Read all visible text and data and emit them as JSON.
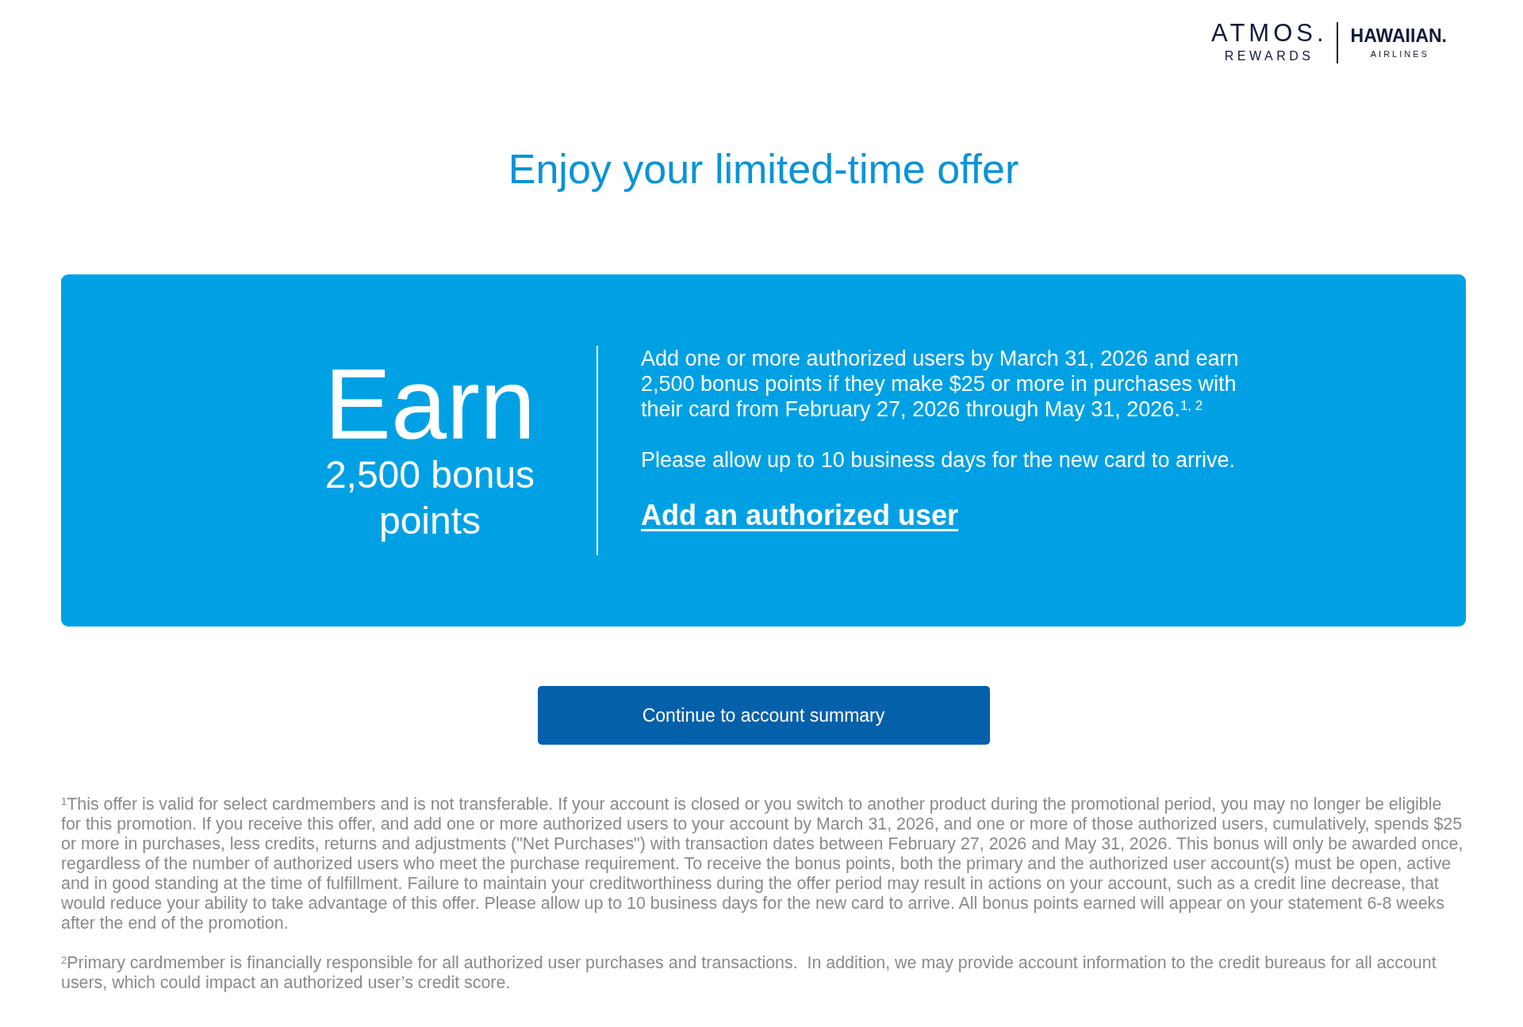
{
  "header": {
    "logo": {
      "wordmark": "ATMOS.",
      "tagline": "REWARDS",
      "partner_wordmark": "HAWAIIAN.",
      "partner_tagline": "AIRLINES"
    }
  },
  "title": "Enjoy your limited-time offer",
  "offer_card": {
    "headline": "Earn",
    "subheadline": "2,500 bonus points",
    "paragraphs": [
      "Add one or more authorized users by March 31, 2026 and earn 2,500 bonus points if they make $25 or more in purchases with their card from February 27, 2026 through May 31, 2026.$^{1, 2}$",
      "Please allow up to 10 business days for the new card to arrive."
    ],
    "link": "Add an authorized user"
  },
  "button": "Continue to account summary",
  "footnotes": [
    "$^{1}$This offer is valid for select cardmembers and is not transferable. If your account is closed or you switch to another product during the promotional period, you may no longer be eligible for this promotion. If you receive this offer, and add one or more authorized users to your account by March 31, 2026, and one or more of those authorized users, cumulatively, spends $25 or more in purchases, less credits, returns and adjustments (\"Net Purchases\") with transaction dates between February 27, 2026 and May 31, 2026. This bonus will only be awarded once, regardless of the number of authorized users who meet the purchase requirement. To receive the bonus points, both the primary and the authorized user account(s) must be open, active and in good standing at the time of fulfillment. Failure to maintain your creditworthiness during the offer period may result in actions on your account, such as a credit line decrease, that would reduce your ability to take advantage of this offer. Please allow up to 10 business days for the new card to arrive. All bonus points earned will appear on your statement 6-8 weeks after the end of the promotion.",
    "$^{2}$Primary cardmember is financially responsible for all authorized user purchases and transactions.  In addition, we may provide account information to the credit bureaus for all account users, which could impact an authorized user’s credit score."
  ]
}
